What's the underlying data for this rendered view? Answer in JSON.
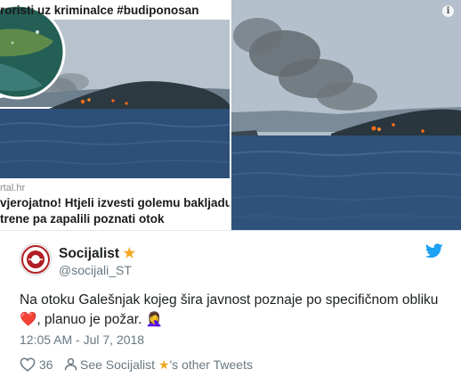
{
  "media": {
    "left_card": {
      "caption_top": "roristi uz kriminalce #budiponosan",
      "site_label": "rtal.hr",
      "headline_line1": "vjerojatno! Htjeli izvesti golemu bakljadu",
      "headline_line2": "trene pa zapalili poznati otok"
    },
    "info_icon": "i"
  },
  "tweet": {
    "author": {
      "display_name": "Socijalist",
      "badge_icon": "star-icon",
      "badge_glyph": "★",
      "handle": "@socijali_ST"
    },
    "text": "Na otoku Galešnjak kojeg šira javnost poznaje po specifičnom obliku",
    "heart_glyph": "❤️",
    "text_after": ", planuo je požar.",
    "emoji_after": "🤦‍♀️",
    "timestamp": "12:05 AM - Jul 7, 2018",
    "like_count": "36",
    "see_profile_prefix": "See Socijalist",
    "see_profile_suffix": "'s other Tweets"
  },
  "colors": {
    "twitter_blue": "#1da1f2",
    "muted_text": "#697882",
    "star": "#f5a623",
    "heart": "#cf2d3a"
  }
}
